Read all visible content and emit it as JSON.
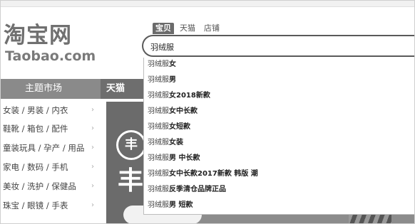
{
  "logo": {
    "chinese": "淘宝网",
    "english": "Taobao.com"
  },
  "search": {
    "tabs": [
      {
        "label": "宝贝",
        "active": true
      },
      {
        "label": "天猫",
        "active": false
      },
      {
        "label": "店铺",
        "active": false
      }
    ],
    "query": "羽绒服",
    "suggestions": [
      {
        "prefix": "羽绒服",
        "rest": "女"
      },
      {
        "prefix": "羽绒服",
        "rest": "男"
      },
      {
        "prefix": "羽绒服",
        "rest": "女2018新款"
      },
      {
        "prefix": "羽绒服",
        "rest": "女中长款"
      },
      {
        "prefix": "羽绒服",
        "rest": "女短款"
      },
      {
        "prefix": "羽绒服",
        "rest": "女装"
      },
      {
        "prefix": "羽绒服",
        "rest": "男 中长款"
      },
      {
        "prefix": "羽绒服",
        "rest": "女中长款2017新款 韩版 潮"
      },
      {
        "prefix": "羽绒服",
        "rest": "反季清仓品牌正品"
      },
      {
        "prefix": "羽绒服",
        "rest": "男 短款"
      }
    ]
  },
  "nav": {
    "title": "主题市场",
    "items": [
      {
        "label": "女装 / 男装 / 内衣",
        "arrow": "›"
      },
      {
        "label": "鞋靴 / 箱包 / 配件",
        "arrow": "›"
      },
      {
        "label": "童装玩具 / 孕产 / 用品",
        "arrow": "›"
      },
      {
        "label": "家电 / 数码 / 手机",
        "arrow": "›"
      },
      {
        "label": "美妆 / 洗护 / 保健品",
        "arrow": "›"
      },
      {
        "label": "珠宝 / 眼镜 / 手表",
        "arrow": "›"
      }
    ]
  },
  "main": {
    "tab_label": "天猫"
  },
  "banner": {
    "badge": "丰",
    "big_text": "丰"
  },
  "colors": {
    "nav_header": "#8a8a8a",
    "main_bar": "#6e6e6e",
    "search_border": "#5a5a5a"
  }
}
